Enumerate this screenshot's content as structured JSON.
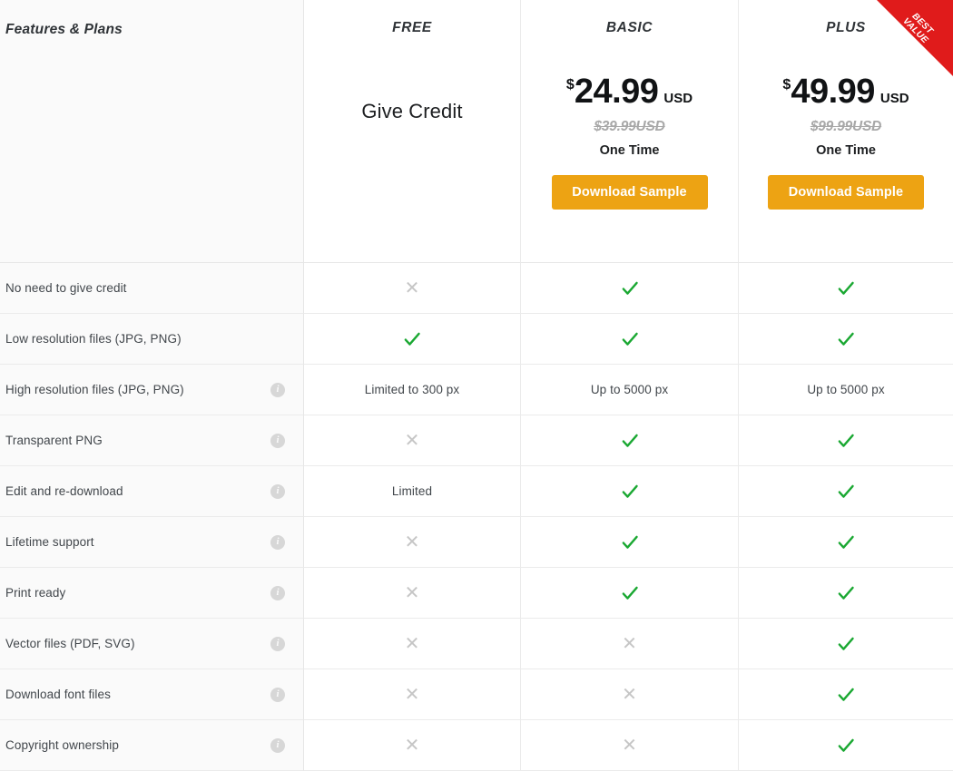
{
  "table": {
    "feature_column_header": "Features & Plans",
    "plans": [
      {
        "name": "FREE",
        "tagline": "Give Credit",
        "has_price": false,
        "best_value": false
      },
      {
        "name": "BASIC",
        "has_price": true,
        "currency_symbol": "$",
        "price": "24.99",
        "currency": "USD",
        "old_price": "$39.99USD",
        "term": "One Time",
        "button_label": "Download Sample",
        "best_value": false
      },
      {
        "name": "PLUS",
        "has_price": true,
        "currency_symbol": "$",
        "price": "49.99",
        "currency": "USD",
        "old_price": "$99.99USD",
        "term": "One Time",
        "button_label": "Download Sample",
        "best_value": true,
        "ribbon_line1": "BEST",
        "ribbon_line2": "VALUE"
      }
    ],
    "rows": [
      {
        "label": "No need to give credit",
        "has_info": false,
        "values": [
          {
            "type": "cross",
            "glyph": "✕"
          },
          {
            "type": "check"
          },
          {
            "type": "check"
          }
        ]
      },
      {
        "label": "Low resolution files (JPG, PNG)",
        "has_info": false,
        "values": [
          {
            "type": "check"
          },
          {
            "type": "check"
          },
          {
            "type": "check"
          }
        ]
      },
      {
        "label": "High resolution files (JPG, PNG)",
        "has_info": true,
        "values": [
          {
            "type": "text",
            "text": "Limited to 300 px"
          },
          {
            "type": "text",
            "text": "Up to 5000 px"
          },
          {
            "type": "text",
            "text": "Up to 5000 px"
          }
        ]
      },
      {
        "label": "Transparent PNG",
        "has_info": true,
        "values": [
          {
            "type": "cross",
            "glyph": "✕"
          },
          {
            "type": "check"
          },
          {
            "type": "check"
          }
        ]
      },
      {
        "label": "Edit and re-download",
        "has_info": true,
        "values": [
          {
            "type": "text",
            "text": "Limited"
          },
          {
            "type": "check"
          },
          {
            "type": "check"
          }
        ]
      },
      {
        "label": "Lifetime support",
        "has_info": true,
        "values": [
          {
            "type": "cross",
            "glyph": "✕"
          },
          {
            "type": "check"
          },
          {
            "type": "check"
          }
        ]
      },
      {
        "label": "Print ready",
        "has_info": true,
        "values": [
          {
            "type": "cross",
            "glyph": "✕"
          },
          {
            "type": "check"
          },
          {
            "type": "check"
          }
        ]
      },
      {
        "label": "Vector files (PDF, SVG)",
        "has_info": true,
        "values": [
          {
            "type": "cross",
            "glyph": "✕"
          },
          {
            "type": "cross",
            "glyph": "✕"
          },
          {
            "type": "check"
          }
        ]
      },
      {
        "label": "Download font files",
        "has_info": true,
        "values": [
          {
            "type": "cross",
            "glyph": "✕"
          },
          {
            "type": "cross",
            "glyph": "✕"
          },
          {
            "type": "check"
          }
        ]
      },
      {
        "label": "Copyright ownership",
        "has_info": true,
        "values": [
          {
            "type": "cross",
            "glyph": "✕"
          },
          {
            "type": "cross",
            "glyph": "✕"
          },
          {
            "type": "check"
          }
        ]
      }
    ],
    "info_icon_glyph": "i"
  },
  "colors": {
    "check_green": "#1aa832",
    "cross_gray": "#c6c6c6",
    "button_orange": "#eda313",
    "ribbon_red": "#e01b1b",
    "feature_column_bg": "#fafafa",
    "border": "#ebebeb",
    "text_dark": "#1d1f21",
    "text_muted": "#41464b",
    "old_price_gray": "#a8a8a8"
  }
}
